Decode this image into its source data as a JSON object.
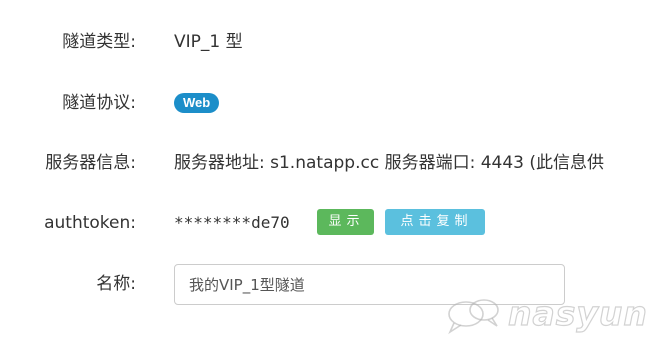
{
  "form": {
    "tunnel_type": {
      "label": "隧道类型:",
      "value": "VIP_1 型"
    },
    "tunnel_protocol": {
      "label": "隧道协议:",
      "badge": "Web",
      "badge_color": "#1c8ec9"
    },
    "server_info": {
      "label": "服务器信息:",
      "value": "服务器地址: s1.natapp.cc 服务器端口: 4443 (此信息供"
    },
    "authtoken": {
      "label": "authtoken:",
      "value": "********de70",
      "show_button": "显示",
      "show_button_color": "#5cb85c",
      "copy_button": "点击复制",
      "copy_button_color": "#5bc0de"
    },
    "name": {
      "label": "名称:",
      "value": "我的VIP_1型隧道"
    }
  },
  "watermark": {
    "text": "nasyun",
    "icon": "chat-bubbles-logo-icon"
  }
}
